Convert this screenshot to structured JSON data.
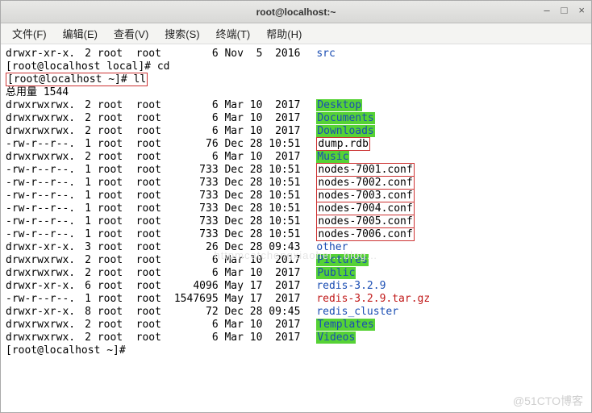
{
  "titlebar": {
    "title": "root@localhost:~"
  },
  "window_controls": {
    "min": "–",
    "max": "□",
    "close": "×"
  },
  "menubar": {
    "file": "文件(F)",
    "edit": "编辑(E)",
    "view": "查看(V)",
    "search": "搜索(S)",
    "term": "终端(T)",
    "help": "帮助(H)"
  },
  "pre_prompt": {
    "line_src": {
      "perms": "drwxr-xr-x.",
      "links": "2",
      "owner": "root",
      "group": "root",
      "size": "6",
      "date": "Nov  5  2016",
      "name": "src",
      "style": "blue"
    },
    "cd_line": "[root@localhost local]# cd",
    "ll_line": "[root@localhost ~]# ll",
    "total": "总用量 1544"
  },
  "rows": [
    {
      "perms": "drwxrwxrwx.",
      "links": "2",
      "owner": "root",
      "group": "root",
      "size": "6",
      "date": "Mar 10  2017",
      "name": "Desktop",
      "style": "hl-green"
    },
    {
      "perms": "drwxrwxrwx.",
      "links": "2",
      "owner": "root",
      "group": "root",
      "size": "6",
      "date": "Mar 10  2017",
      "name": "Documents",
      "style": "hl-green"
    },
    {
      "perms": "drwxrwxrwx.",
      "links": "2",
      "owner": "root",
      "group": "root",
      "size": "6",
      "date": "Mar 10  2017",
      "name": "Downloads",
      "style": "hl-green"
    },
    {
      "perms": "-rw-r--r--.",
      "links": "1",
      "owner": "root",
      "group": "root",
      "size": "76",
      "date": "Dec 28 10:51",
      "name": "dump.rdb",
      "style": "box-red"
    },
    {
      "perms": "drwxrwxrwx.",
      "links": "2",
      "owner": "root",
      "group": "root",
      "size": "6",
      "date": "Mar 10  2017",
      "name": "Music",
      "style": "hl-green"
    },
    {
      "perms": "-rw-r--r--.",
      "links": "1",
      "owner": "root",
      "group": "root",
      "size": "733",
      "date": "Dec 28 10:51",
      "name": "nodes-7001.conf",
      "style": "box-red"
    },
    {
      "perms": "-rw-r--r--.",
      "links": "1",
      "owner": "root",
      "group": "root",
      "size": "733",
      "date": "Dec 28 10:51",
      "name": "nodes-7002.conf",
      "style": "box-red"
    },
    {
      "perms": "-rw-r--r--.",
      "links": "1",
      "owner": "root",
      "group": "root",
      "size": "733",
      "date": "Dec 28 10:51",
      "name": "nodes-7003.conf",
      "style": "box-red"
    },
    {
      "perms": "-rw-r--r--.",
      "links": "1",
      "owner": "root",
      "group": "root",
      "size": "733",
      "date": "Dec 28 10:51",
      "name": "nodes-7004.conf",
      "style": "box-red"
    },
    {
      "perms": "-rw-r--r--.",
      "links": "1",
      "owner": "root",
      "group": "root",
      "size": "733",
      "date": "Dec 28 10:51",
      "name": "nodes-7005.conf",
      "style": "box-red"
    },
    {
      "perms": "-rw-r--r--.",
      "links": "1",
      "owner": "root",
      "group": "root",
      "size": "733",
      "date": "Dec 28 10:51",
      "name": "nodes-7006.conf",
      "style": "box-red"
    },
    {
      "perms": "drwxr-xr-x.",
      "links": "3",
      "owner": "root",
      "group": "root",
      "size": "26",
      "date": "Dec 28 09:43",
      "name": "other",
      "style": "blue"
    },
    {
      "perms": "drwxrwxrwx.",
      "links": "2",
      "owner": "root",
      "group": "root",
      "size": "6",
      "date": "Mar 10  2017",
      "name": "Pictures",
      "style": "hl-green"
    },
    {
      "perms": "drwxrwxrwx.",
      "links": "2",
      "owner": "root",
      "group": "root",
      "size": "6",
      "date": "Mar 10  2017",
      "name": "Public",
      "style": "hl-green"
    },
    {
      "perms": "drwxr-xr-x.",
      "links": "6",
      "owner": "root",
      "group": "root",
      "size": "4096",
      "date": "May 17  2017",
      "name": "redis-3.2.9",
      "style": "blue"
    },
    {
      "perms": "-rw-r--r--.",
      "links": "1",
      "owner": "root",
      "group": "root",
      "size": "1547695",
      "date": "May 17  2017",
      "name": "redis-3.2.9.tar.gz",
      "style": "red"
    },
    {
      "perms": "drwxr-xr-x.",
      "links": "8",
      "owner": "root",
      "group": "root",
      "size": "72",
      "date": "Dec 28 09:45",
      "name": "redis_cluster",
      "style": "blue"
    },
    {
      "perms": "drwxrwxrwx.",
      "links": "2",
      "owner": "root",
      "group": "root",
      "size": "6",
      "date": "Mar 10  2017",
      "name": "Templates",
      "style": "hl-green"
    },
    {
      "perms": "drwxrwxrwx.",
      "links": "2",
      "owner": "root",
      "group": "root",
      "size": "6",
      "date": "Mar 10  2017",
      "name": "Videos",
      "style": "hl-green"
    }
  ],
  "prompt_after": "[root@localhost ~]# ",
  "watermark": "@51CTO博客",
  "faint_center": "httpmcatchengxiaohei…blog…"
}
